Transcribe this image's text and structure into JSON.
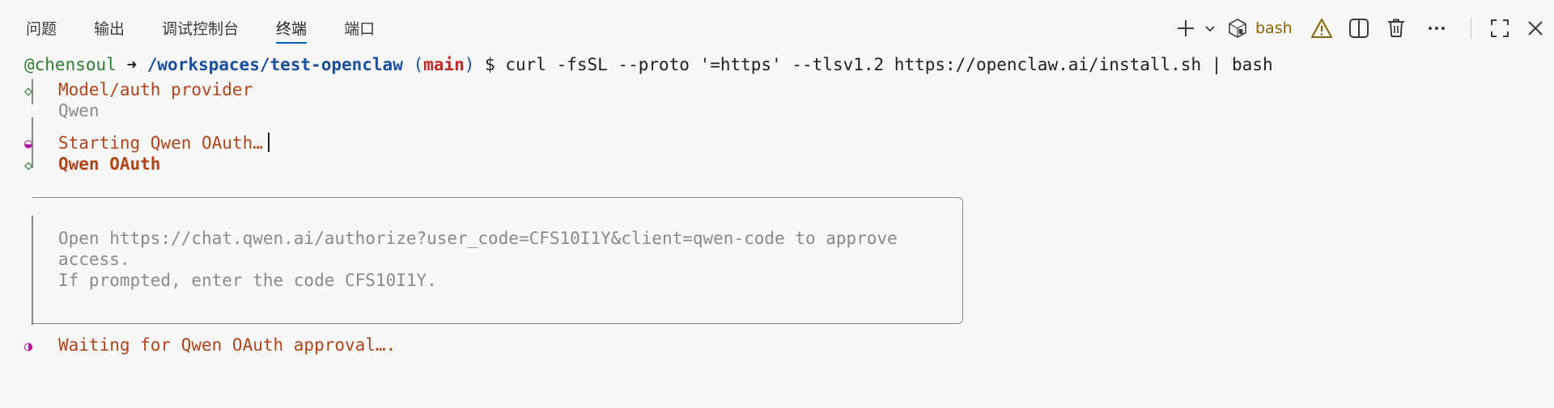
{
  "tabs": [
    {
      "label": "问题"
    },
    {
      "label": "输出"
    },
    {
      "label": "调试控制台"
    },
    {
      "label": "终端",
      "active": true
    },
    {
      "label": "端口"
    }
  ],
  "toolbar": {
    "shell_label": "bash",
    "icons": [
      "plus-icon",
      "chevron-down-icon",
      "terminal-shell-icon",
      "warning-icon",
      "split-pane-icon",
      "trash-icon",
      "more-icon",
      "maximize-icon",
      "close-icon"
    ]
  },
  "terminal": {
    "prompt_user": "@chensoul",
    "prompt_arrow": "➜",
    "prompt_path": "/workspaces/test-openclaw",
    "prompt_paren_open": "(",
    "prompt_branch": "main",
    "prompt_paren_close": ")",
    "prompt_dollar": "$",
    "command": "curl -fsSL --proto '=https' --tlsv1.2 https://openclaw.ai/install.sh | bash",
    "step1_title": "Model/auth provider",
    "step1_value": "Qwen",
    "step2_title": "Starting Qwen OAuth…",
    "step3_title": "Qwen OAuth",
    "box_line1": "Open https://chat.qwen.ai/authorize?user_code=CFS10I1Y&client=qwen-code to approve",
    "box_line2": "access.",
    "box_line3": "If prompted, enter the code CFS10I1Y.",
    "step4_title": "Waiting for Qwen OAuth approval….",
    "glyph_diamond": "◇",
    "glyph_half": "◒",
    "glyph_half2": "◑"
  },
  "colors": {
    "accent": "#005fb8",
    "prompt_green": "#2e7d32",
    "path_blue": "#1a4fa0",
    "branch_red": "#c62828",
    "step_orange": "#b1431b",
    "muted_gray": "#8a8a8a",
    "spinner_magenta": "#b5179e",
    "warning": "#8a6400"
  }
}
